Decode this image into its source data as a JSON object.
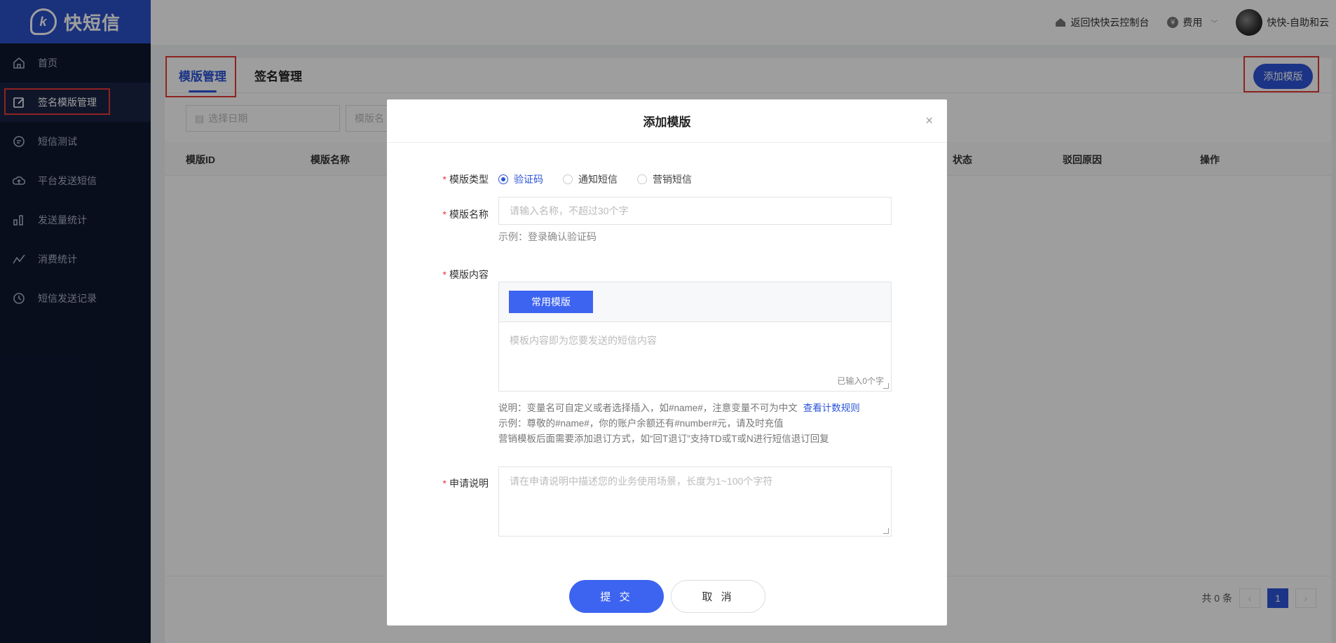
{
  "app": {
    "logo_text": "快短信",
    "logo_mark": "k"
  },
  "sidebar": {
    "items": [
      {
        "label": "首页",
        "icon": "home-icon"
      },
      {
        "label": "签名模版管理",
        "icon": "edit-icon"
      },
      {
        "label": "短信测试",
        "icon": "message-icon"
      },
      {
        "label": "平台发送短信",
        "icon": "cloud-icon"
      },
      {
        "label": "发送量统计",
        "icon": "bar-chart-icon"
      },
      {
        "label": "消费统计",
        "icon": "trend-icon"
      },
      {
        "label": "短信发送记录",
        "icon": "clock-icon"
      }
    ],
    "active_index": 1
  },
  "header": {
    "back_console": "返回快快云控制台",
    "fees": "费用",
    "username": "快快-自助和云"
  },
  "main": {
    "tabs": [
      "模版管理",
      "签名管理"
    ],
    "active_tab": 0,
    "add_button": "添加模版",
    "filters": {
      "date_placeholder": "选择日期",
      "name_placeholder": "模版名"
    },
    "columns": [
      "模版ID",
      "模版名称",
      "状态",
      "驳回原因",
      "操作"
    ],
    "pagination": {
      "total_text": "共 0 条",
      "current_page": "1",
      "prev": "‹",
      "next": "›"
    }
  },
  "modal": {
    "title": "添加模版",
    "close": "×",
    "type": {
      "label": "模版类型",
      "options": [
        "验证码",
        "通知短信",
        "营销短信"
      ],
      "selected_index": 0
    },
    "name": {
      "label": "模版名称",
      "placeholder": "请输入名称，不超过30个字",
      "example": "示例：登录确认验证码"
    },
    "content": {
      "label": "模版内容",
      "common_button": "常用模版",
      "placeholder": "模板内容即为您要发送的短信内容",
      "count_text": "已输入0个字",
      "note1": "说明：变量名可自定义或者选择插入，如#name#，注意变量不可为中文",
      "note_link": "查看计数规则",
      "note2": "示例：尊敬的#name#，你的账户余额还有#number#元，请及时充值",
      "note3": "营销模板后面需要添加退订方式，如“回T退订”支持TD或T或N进行短信退订回复"
    },
    "apply": {
      "label": "申请说明",
      "placeholder": "请在申请说明中描述您的业务使用场景，长度为1~100个字符"
    },
    "submit": "提 交",
    "cancel": "取 消",
    "required_mark": "*"
  }
}
